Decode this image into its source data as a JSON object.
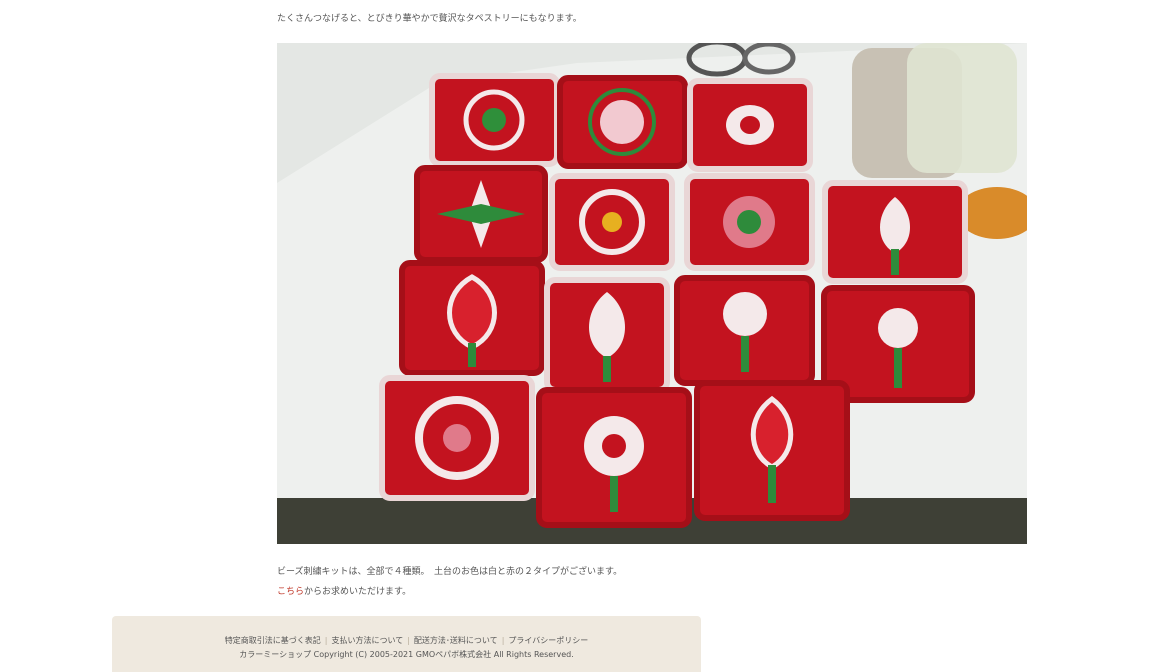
{
  "content": {
    "intro_text": "たくさんつなげると、とびきり華やかで贅沢なタペストリーにもなります。",
    "photo_alt": "ビーズ刺繍のタペストリー",
    "caption_line1": "ビーズ刺繍キットは、全部で４種類。　土台のお色は白と赤の２タイプがございます。",
    "caption_link": "こちら",
    "caption_line2_rest": "からお求めいただけます。"
  },
  "footer": {
    "links": [
      "特定商取引法に基づく表記",
      "支払い方法について",
      "配送方法･送料について",
      "プライバシーポリシー"
    ],
    "separator": "|",
    "copyright": "カラーミーショップ Copyright (C) 2005-2021 GMOペパボ株式会社 All Rights Reserved."
  },
  "colors": {
    "link": "#c0392b",
    "footer_bg": "#efe9df",
    "text": "#555555"
  }
}
